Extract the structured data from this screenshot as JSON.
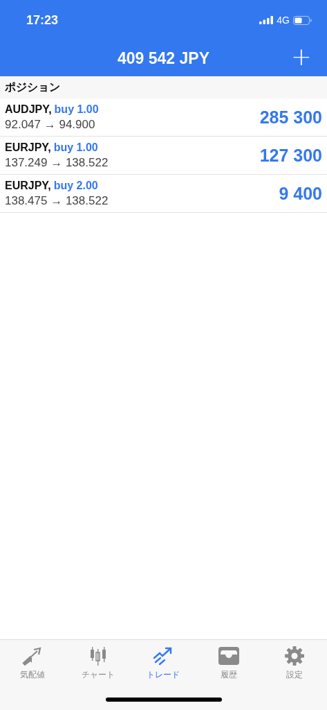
{
  "status_bar": {
    "time": "17:23",
    "network": "4G"
  },
  "header": {
    "title": "409 542 JPY",
    "add_icon": "+"
  },
  "section": {
    "title": "ポジション"
  },
  "positions": [
    {
      "symbol": "AUDJPY,",
      "order": "buy 1.00",
      "prices": "92.047 → 94.900",
      "profit": "285 300"
    },
    {
      "symbol": "EURJPY,",
      "order": "buy 1.00",
      "prices": "137.249 → 138.522",
      "profit": "127 300"
    },
    {
      "symbol": "EURJPY,",
      "order": "buy 2.00",
      "prices": "138.475 → 138.522",
      "profit": "9 400"
    }
  ],
  "tabs": [
    {
      "label": "気配値",
      "selected": false
    },
    {
      "label": "チャート",
      "selected": false
    },
    {
      "label": "トレード",
      "selected": true
    },
    {
      "label": "履歴",
      "selected": false
    },
    {
      "label": "設定",
      "selected": false
    }
  ]
}
